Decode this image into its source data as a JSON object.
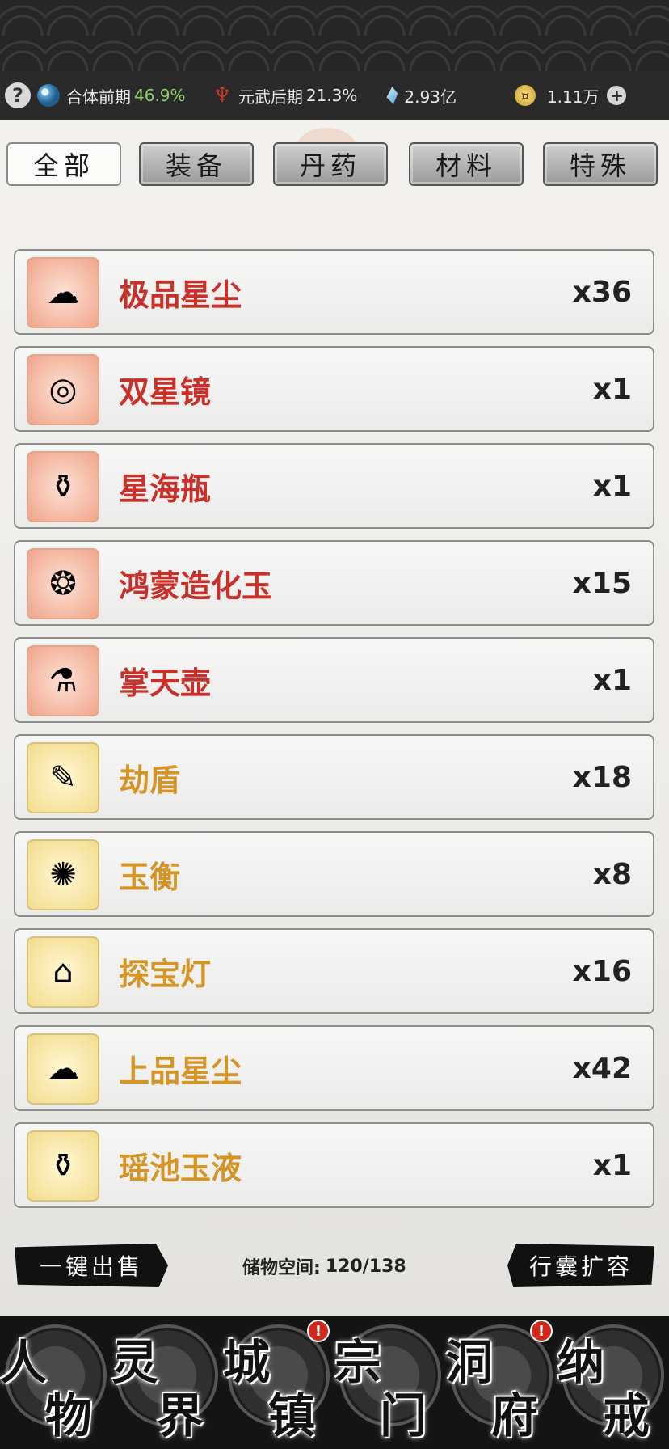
{
  "status": {
    "help": "?",
    "realm": "合体前期",
    "realm_pct": "46.9%",
    "martial": "元武后期",
    "martial_pct": "21.3%",
    "spirit_stones": "2.93亿",
    "gold": "1.11万",
    "plus": "+"
  },
  "tabs": [
    "全部",
    "装备",
    "丹药",
    "材料",
    "特殊"
  ],
  "items": [
    {
      "name": "极品星尘",
      "count": "x36",
      "tier": "red",
      "icon": "stardust-icon"
    },
    {
      "name": "双星镜",
      "count": "x1",
      "tier": "red",
      "icon": "mirror-icon"
    },
    {
      "name": "星海瓶",
      "count": "x1",
      "tier": "red",
      "icon": "bottle-icon"
    },
    {
      "name": "鸿蒙造化玉",
      "count": "x15",
      "tier": "red",
      "icon": "jade-icon"
    },
    {
      "name": "掌天壶",
      "count": "x1",
      "tier": "red",
      "icon": "pot-icon"
    },
    {
      "name": "劫盾",
      "count": "x18",
      "tier": "gold",
      "icon": "talisman-icon"
    },
    {
      "name": "玉衡",
      "count": "x8",
      "tier": "gold",
      "icon": "gold-disc-icon"
    },
    {
      "name": "探宝灯",
      "count": "x16",
      "tier": "gold",
      "icon": "lantern-icon"
    },
    {
      "name": "上品星尘",
      "count": "x42",
      "tier": "gold",
      "icon": "stardust-icon"
    },
    {
      "name": "瑶池玉液",
      "count": "x1",
      "tier": "gold",
      "icon": "vase-icon"
    }
  ],
  "footer": {
    "sell_all": "一键出售",
    "storage_label": "储物空间:",
    "storage_value": "120/138",
    "expand": "行囊扩容"
  },
  "nav": [
    {
      "c1": "人",
      "c2": "物",
      "badge": false
    },
    {
      "c1": "灵",
      "c2": "界",
      "badge": false
    },
    {
      "c1": "城",
      "c2": "镇",
      "badge": true
    },
    {
      "c1": "宗",
      "c2": "门",
      "badge": false
    },
    {
      "c1": "洞",
      "c2": "府",
      "badge": true
    },
    {
      "c1": "纳",
      "c2": "戒",
      "badge": false
    }
  ],
  "badge_mark": "!",
  "colors": {
    "red_tier": "#c8302a",
    "gold_tier": "#d49526",
    "realm_pct": "#8fcf6b"
  }
}
